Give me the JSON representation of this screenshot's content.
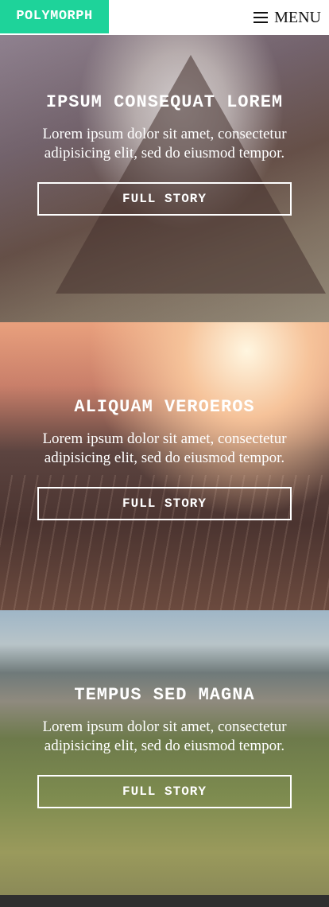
{
  "header": {
    "logo": "POLYMORPH",
    "menu_label": "MENU"
  },
  "articles": [
    {
      "title": "IPSUM CONSEQUAT LOREM",
      "text": "Lorem ipsum dolor sit amet, consectetur adipisicing elit, sed do eiusmod tempor.",
      "button": "FULL STORY"
    },
    {
      "title": "ALIQUAM VEROEROS",
      "text": "Lorem ipsum dolor sit amet, consectetur adipisicing elit, sed do eiusmod tempor.",
      "button": "FULL STORY"
    },
    {
      "title": "TEMPUS SED MAGNA",
      "text": "Lorem ipsum dolor sit amet, consectetur adipisicing elit, sed do eiusmod tempor.",
      "button": "FULL STORY"
    }
  ],
  "colors": {
    "brand": "#1ed39a",
    "footer": "#2f2f2f"
  }
}
